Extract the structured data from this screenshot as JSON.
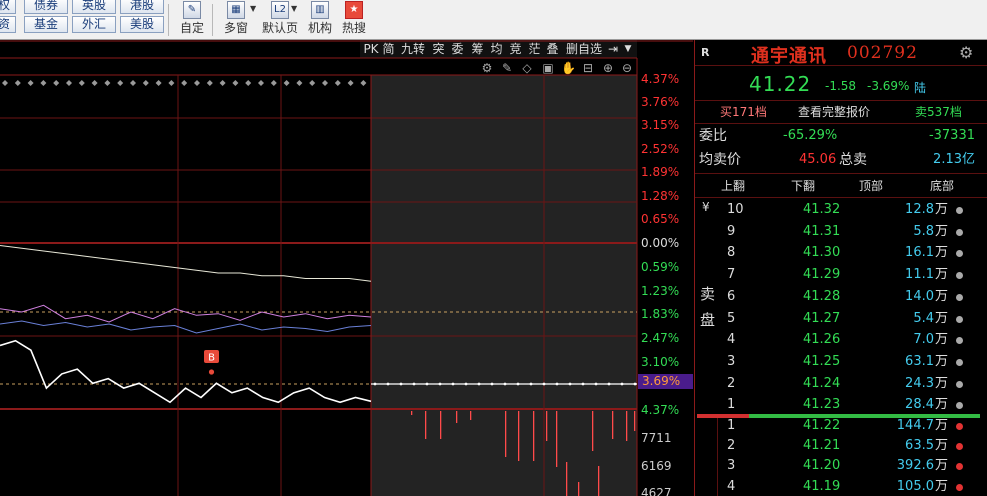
{
  "toolbar": {
    "row1": [
      "权",
      "债券",
      "英股",
      "港股"
    ],
    "row2": [
      "资",
      "基金",
      "外汇",
      "美股"
    ],
    "tools": [
      {
        "label": "自定",
        "icon": "edit-icon"
      },
      {
        "label": "多窗",
        "icon": "multi-window-icon"
      },
      {
        "label": "默认页",
        "icon": "l2-icon",
        "icon_text": "L2"
      },
      {
        "label": "机构",
        "icon": "institution-icon"
      },
      {
        "label": "热搜",
        "icon": "hot-search-icon"
      }
    ]
  },
  "chart_tabs": [
    "PK",
    "简",
    "九转",
    "突",
    "委",
    "筹",
    "均",
    "竞",
    "茫",
    "叠",
    "删自选"
  ],
  "chart_data": {
    "type": "line",
    "price_axis_labels": [
      "4.37%",
      "3.76%",
      "3.15%",
      "2.52%",
      "1.89%",
      "1.28%",
      "0.65%",
      "0.00%",
      "0.59%",
      "1.23%",
      "1.83%",
      "2.47%",
      "3.10%",
      "3.69%",
      "4.37%"
    ],
    "current_change_label": "3.69%",
    "volume_axis_labels": [
      "7711",
      "6169",
      "4627"
    ],
    "buy_marker": "B",
    "series": [
      {
        "values": [
          43.2,
          43.1,
          43.3,
          42.9,
          43.0,
          42.8,
          43.1,
          42.9,
          43.2,
          43.0,
          43.05,
          42.85,
          43.1,
          42.95,
          43.05,
          42.9,
          43.0,
          42.95
        ]
      },
      {
        "values": [
          42.6,
          42.7,
          42.55,
          42.65,
          42.5,
          42.6,
          42.4,
          42.5,
          42.55,
          42.3,
          42.45,
          42.6,
          42.4,
          42.5,
          42.45,
          42.35,
          42.5,
          42.55
        ]
      },
      {
        "values": [
          43.6,
          43.55,
          43.5,
          43.45,
          43.4,
          43.35,
          43.3,
          43.25,
          43.2,
          43.15,
          43.1,
          43.1,
          43.05,
          43.05,
          43.0,
          43.0,
          43.0,
          42.95
        ]
      },
      {
        "values": [
          42.4,
          42.5,
          42.3,
          41.5,
          41.8,
          41.9,
          41.6,
          41.7,
          41.5,
          41.6,
          41.4,
          41.2,
          41.5,
          41.3,
          41.6,
          41.4,
          41.5,
          41.3,
          41.2,
          41.4,
          41.5,
          41.3,
          41.2,
          41.3,
          41.22
        ]
      }
    ]
  },
  "stock": {
    "flag": "R",
    "name": "通宇通讯",
    "code": "002792",
    "price": "41.22",
    "change": "-1.58",
    "change_pct": "-3.69%",
    "market": "陆",
    "buy_levels_btn": "买171档",
    "full_quote_btn": "查看完整报价",
    "sell_levels_btn": "卖537档"
  },
  "stats": {
    "weibi_label": "委比",
    "weibi_pct": "-65.29%",
    "weibi_diff": "-37331",
    "avg_sell_label": "均卖价",
    "avg_sell_price": "45.06",
    "total_sell_label": "总卖",
    "total_sell_amount": "2.13亿"
  },
  "orderbook_tabs": [
    "上翻",
    "下翻",
    "顶部",
    "底部"
  ],
  "sell_side": {
    "currency": "¥",
    "label_top": "卖",
    "label_bottom": "盘",
    "rows": [
      {
        "level": "10",
        "price": "41.32",
        "vol": "12.8",
        "unit": "万"
      },
      {
        "level": "9",
        "price": "41.31",
        "vol": "5.8",
        "unit": "万"
      },
      {
        "level": "8",
        "price": "41.30",
        "vol": "16.1",
        "unit": "万"
      },
      {
        "level": "7",
        "price": "41.29",
        "vol": "11.1",
        "unit": "万"
      },
      {
        "level": "6",
        "price": "41.28",
        "vol": "14.0",
        "unit": "万"
      },
      {
        "level": "5",
        "price": "41.27",
        "vol": "5.4",
        "unit": "万"
      },
      {
        "level": "4",
        "price": "41.26",
        "vol": "7.0",
        "unit": "万"
      },
      {
        "level": "3",
        "price": "41.25",
        "vol": "63.1",
        "unit": "万"
      },
      {
        "level": "2",
        "price": "41.24",
        "vol": "24.3",
        "unit": "万"
      },
      {
        "level": "1",
        "price": "41.23",
        "vol": "28.4",
        "unit": "万"
      }
    ]
  },
  "buy_side": {
    "rows": [
      {
        "level": "1",
        "price": "41.22",
        "vol": "144.7",
        "unit": "万"
      },
      {
        "level": "2",
        "price": "41.21",
        "vol": "63.5",
        "unit": "万"
      },
      {
        "level": "3",
        "price": "41.20",
        "vol": "392.6",
        "unit": "万"
      },
      {
        "level": "4",
        "price": "41.19",
        "vol": "105.0",
        "unit": "万"
      }
    ]
  },
  "colors": {
    "price_down": "#33dd55",
    "price_up": "#ff3333",
    "title_red": "#e0301e",
    "grid_red": "#8b1a1a",
    "volume_blue": "#44ccee",
    "indicator_yellow": "#f0e060"
  }
}
